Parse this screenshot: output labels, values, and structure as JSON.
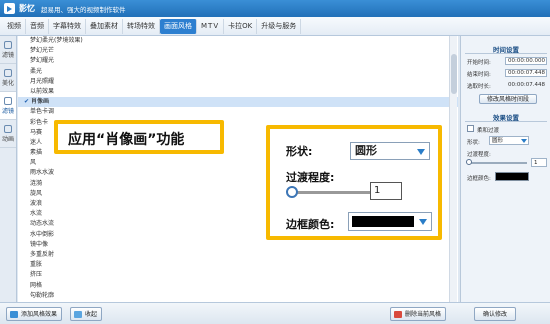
{
  "app": {
    "name": "影忆",
    "slogan": "超易用、强大的视频制作软件"
  },
  "menu": {
    "tabs": [
      "视频",
      "音频",
      "字幕特效",
      "叠加素材",
      "转场特效",
      "画面风格",
      "MTV",
      "卡拉OK",
      "升级与服务"
    ],
    "active": "画面风格"
  },
  "side_tabs": [
    {
      "label": "滤镜",
      "active": false
    },
    {
      "label": "美化",
      "active": false
    },
    {
      "label": "滤镜",
      "active": true
    },
    {
      "label": "动画",
      "active": false
    }
  ],
  "style_list": [
    "梦幻柔光(梦境效果)",
    "梦幻光芒",
    "梦幻耀光",
    "柔光",
    "月光照耀",
    "以前效果",
    "肖像画",
    "单色卡调",
    "彩色卡",
    "马赛",
    "迷人",
    "素描",
    "风",
    "雨水水波",
    "涟漪",
    "旋风",
    "波浪",
    "水流",
    "动态水流",
    "水中倒影",
    "镜中像",
    "多重反射",
    "重胀",
    "挤压",
    "网格",
    "勾勒轮廓"
  ],
  "selected_style": "肖像画",
  "right_panel": {
    "time_title": "时间设置",
    "start_label": "开始时间:",
    "start_value": "00:00:00.000",
    "end_label": "结束时间:",
    "end_value": "00:00:07.448",
    "duration_label": "选取时长:",
    "duration_value": "00:00:07.448",
    "modify_time_button": "修改风格时间段",
    "effect_title": "效果设置",
    "soft_transition_label": "柔和过渡",
    "shape_label": "形状:",
    "shape_value": "圆形",
    "transition_label": "过渡程度:",
    "transition_value": "1",
    "transition_level": 0,
    "border_color_label": "边框颜色:",
    "border_color": "#000000"
  },
  "bottom": {
    "add_style": "添加风格效果",
    "collapse": "收起",
    "delete_style": "删除当前风格",
    "confirm": "确认修改"
  },
  "callout": {
    "text": "应用“肖像画”功能"
  },
  "zoom": {
    "shape_label": "形状:",
    "shape_value": "圆形",
    "transition_label": "过渡程度:",
    "transition_value": "1",
    "border_color_label": "边框颜色:"
  },
  "colors": {
    "accent": "#2d7fd0",
    "highlight": "#f7b900",
    "selected_row": "#cfe2f7"
  }
}
